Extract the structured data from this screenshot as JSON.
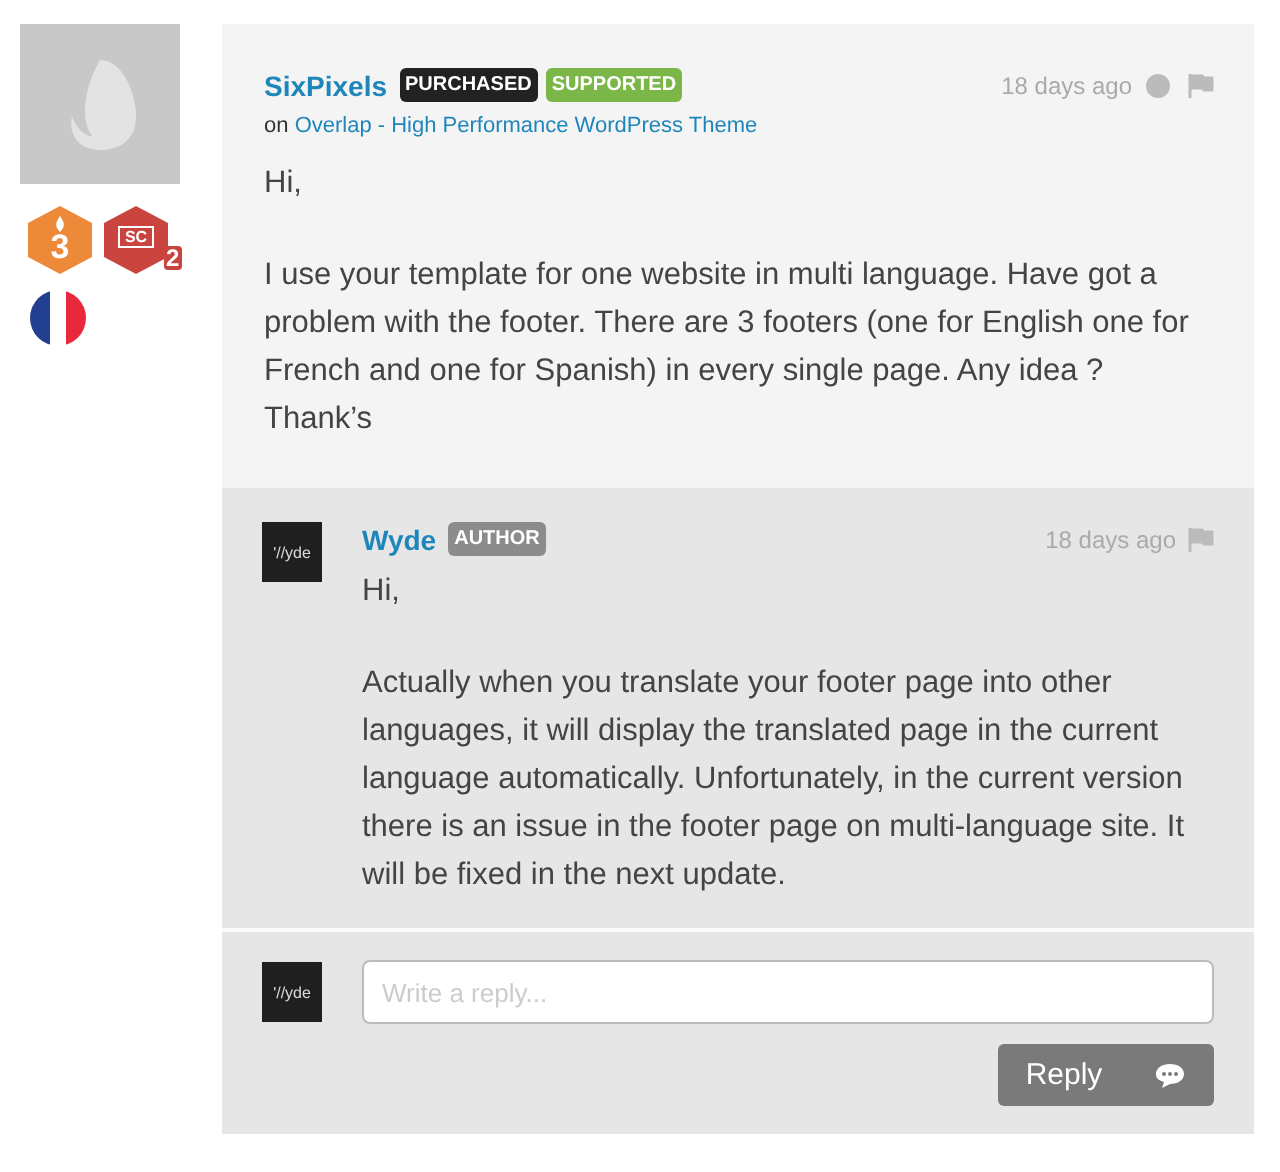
{
  "sidebar": {
    "badges": [
      {
        "kind": "hex",
        "color": "#ec8a3a",
        "number": "3"
      },
      {
        "kind": "hex",
        "color": "#c9433f",
        "label": "SC",
        "number": "2"
      }
    ]
  },
  "comment": {
    "author": "SixPixels",
    "tags": [
      {
        "label": "PURCHASED",
        "color": "#222222"
      },
      {
        "label": "SUPPORTED",
        "color": "#7ab648"
      }
    ],
    "on_prefix": "on",
    "item_link": "Overlap - High Performance WordPress Theme",
    "time": "18 days ago",
    "paragraphs": [
      "Hi,",
      "I use your template for one website in multi language. Have got a problem with the footer. There are 3 footers (one for English one for French and one for Spanish) in every single page. Any idea ? Thank’s"
    ]
  },
  "reply": {
    "avatar_text": "'//yde",
    "author": "Wyde",
    "tags": [
      {
        "label": "AUTHOR",
        "color": "#8c8c8c"
      }
    ],
    "time": "18 days ago",
    "paragraphs": [
      "Hi,",
      "Actually when you translate your footer page into other languages, it will display the translated page in the current language automatically. Unfortunately, in the current version there is an issue in the footer page on multi-language site. It will be fixed in the next update."
    ]
  },
  "reply_form": {
    "avatar_text": "'//yde",
    "placeholder": "Write a reply...",
    "button": "Reply"
  }
}
